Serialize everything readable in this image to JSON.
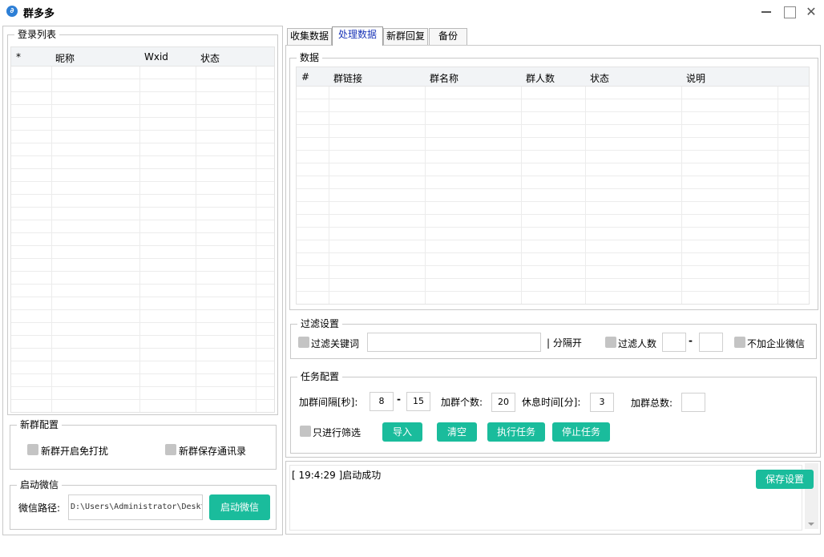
{
  "window": {
    "title": "群多多",
    "app_icon_glyph": "∂"
  },
  "login_list": {
    "legend": "登录列表",
    "columns": [
      "*",
      "昵称",
      "Wxid",
      "状态"
    ]
  },
  "new_group_config": {
    "legend": "新群配置",
    "mute_label": "新群开启免打扰",
    "save_contacts_label": "新群保存通讯录"
  },
  "launch_wechat": {
    "legend": "启动微信",
    "path_label": "微信路径:",
    "path_value": "D:\\Users\\Administrator\\Deskt",
    "launch_button": "启动微信"
  },
  "tabs": [
    "收集数据",
    "处理数据",
    "新群回复",
    "备份"
  ],
  "active_tab": 1,
  "data_section": {
    "legend": "数据",
    "columns": [
      "#",
      "群链接",
      "群名称",
      "群人数",
      "状态",
      "说明"
    ]
  },
  "filter_settings": {
    "legend": "过滤设置",
    "keyword_label": "过滤关键词",
    "keyword_value": "",
    "separator_hint": "| 分隔开",
    "member_filter_label": "过滤人数",
    "min_members": "",
    "dash": "-",
    "max_members": "",
    "exclude_enterprise_label": "不加企业微信"
  },
  "task_config": {
    "legend": "任务配置",
    "interval_label": "加群间隔[秒]:",
    "interval_min": "8",
    "dash": "-",
    "interval_max": "15",
    "count_label": "加群个数:",
    "count_value": "20",
    "rest_label": "休息时间[分]:",
    "rest_value": "3",
    "total_label": "加群总数:",
    "total_value": "",
    "filter_only_label": "只进行筛选",
    "import_button": "导入",
    "clear_button": "清空",
    "execute_button": "执行任务",
    "stop_button": "停止任务"
  },
  "log": {
    "entry": "[ 19:4:29 ]启动成功",
    "save_button": "保存设置"
  },
  "colors": {
    "accent": "#1abc9c",
    "active_tab_text": "#1a35b8",
    "app_icon": "#2d7fd6"
  }
}
